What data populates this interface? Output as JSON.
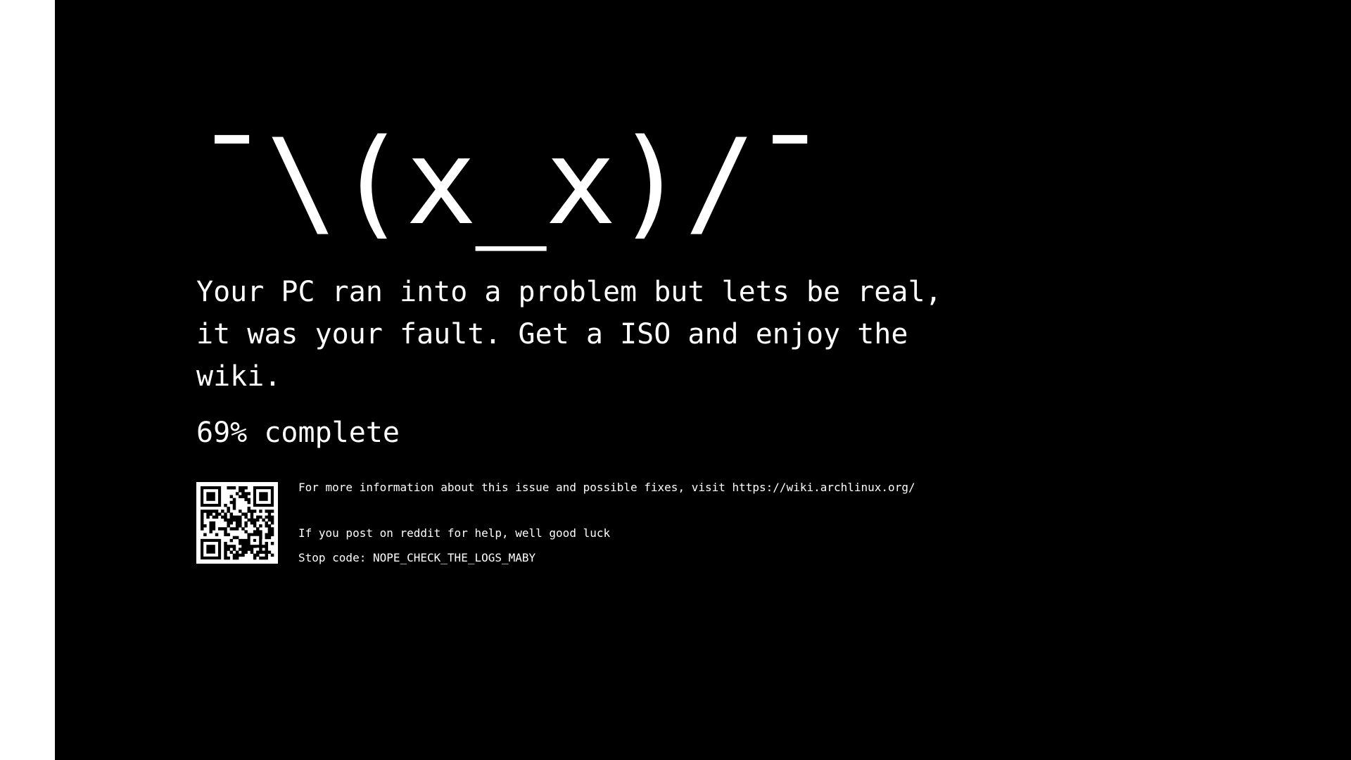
{
  "screen": {
    "face": "¯\\(x_x)/¯",
    "message": "Your PC ran into a problem but lets be real, it was your fault. Get a ISO and enjoy the wiki.",
    "progress_text": "69% complete",
    "progress_percent": 69,
    "info_line": "For more information about this issue and possible fixes, visit https://wiki.archlinux.org/",
    "reddit_line": "If you post on reddit for help, well good luck",
    "stop_code_line": "Stop code: NOPE_CHECK_THE_LOGS_MABY",
    "qr_icon": "qr-code-icon"
  },
  "colors": {
    "background": "#000000",
    "text": "#ffffff",
    "left_strip": "#ffffff"
  }
}
